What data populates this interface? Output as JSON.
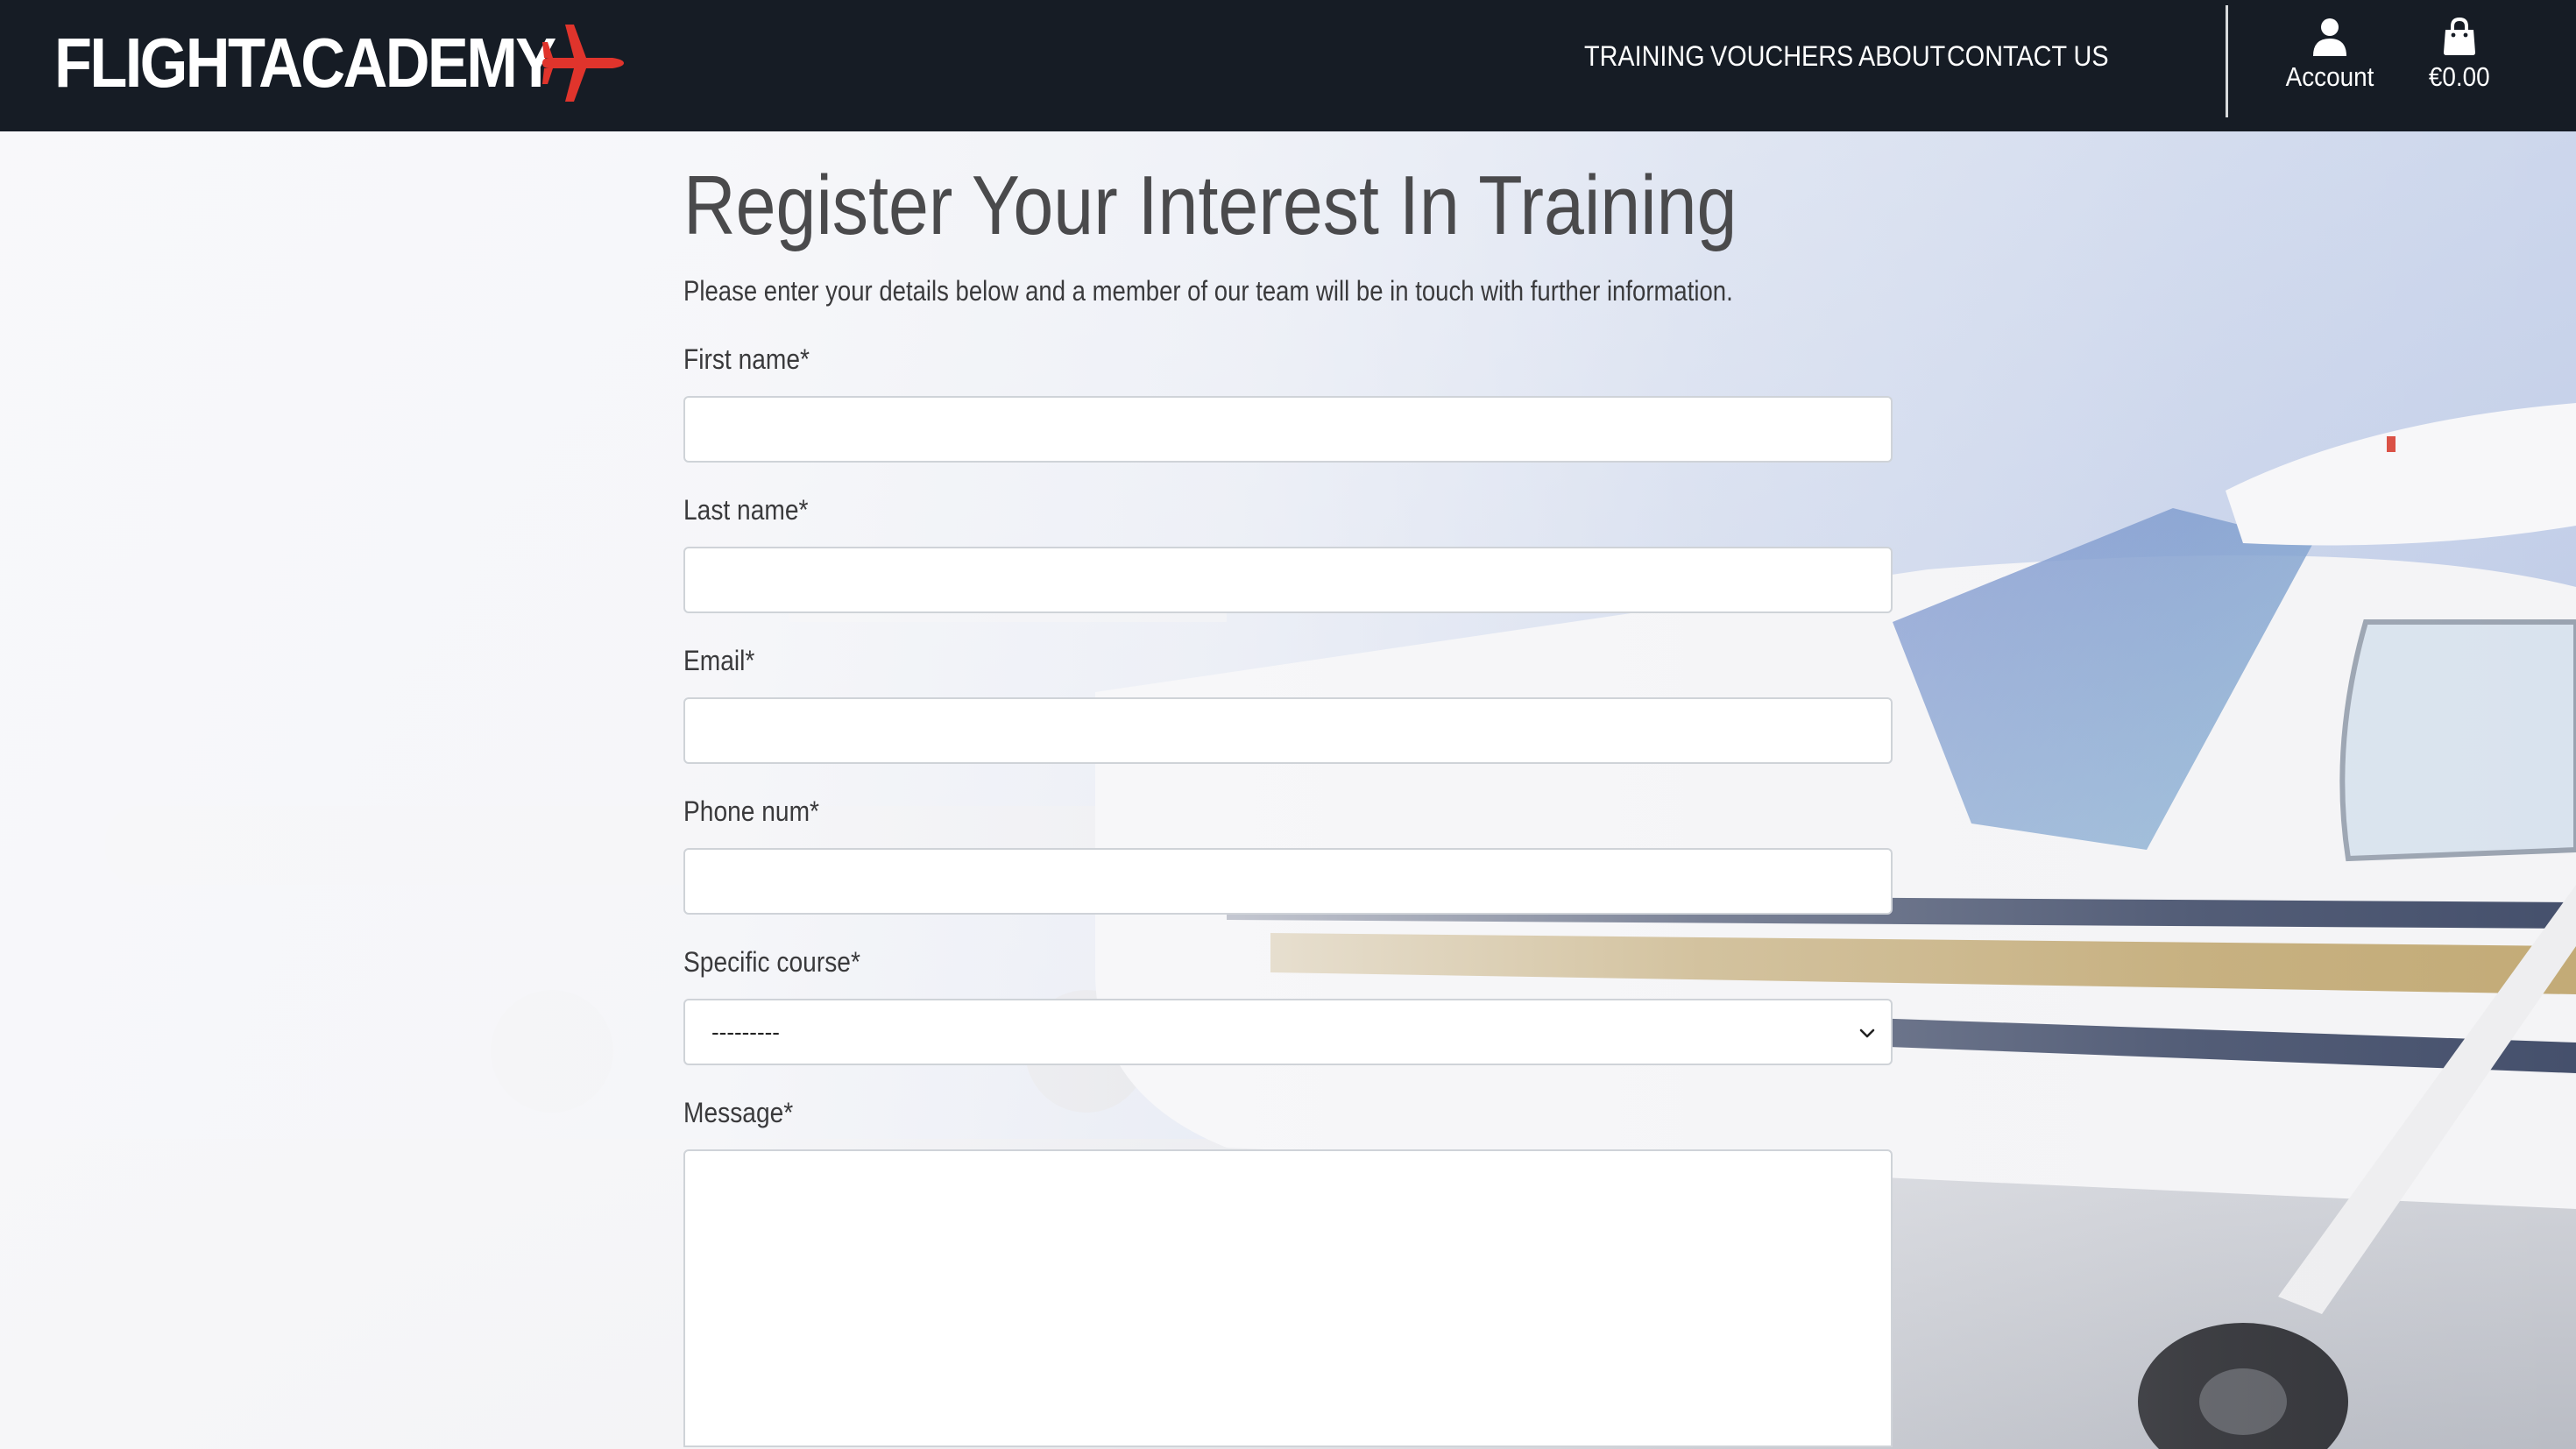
{
  "brand": {
    "name": "FLIGHTACADEMY",
    "logo_icon": "airplane-icon",
    "accent_color": "#e0342c"
  },
  "nav": {
    "links": [
      {
        "label": "TRAINING"
      },
      {
        "label": "VOUCHERS"
      },
      {
        "label": "ABOUT"
      },
      {
        "label": "CONTACT US"
      }
    ],
    "account": {
      "label": "Account",
      "icon": "user-icon"
    },
    "cart": {
      "label": "€0.00",
      "icon": "shopping-bag-icon"
    }
  },
  "page": {
    "title": "Register Your Interest In Training",
    "subtitle": "Please enter your details below and a member of our team will be in touch with further information."
  },
  "form": {
    "first_name": {
      "label": "First name*",
      "value": ""
    },
    "last_name": {
      "label": "Last name*",
      "value": ""
    },
    "email": {
      "label": "Email*",
      "value": ""
    },
    "phone": {
      "label": "Phone num*",
      "value": ""
    },
    "course": {
      "label": "Specific course*",
      "selected": "---------"
    },
    "message": {
      "label": "Message*",
      "value": ""
    }
  },
  "colors": {
    "navbar_bg": "#161c25",
    "text_dark": "#3a3a3c",
    "input_border": "#cfd3d8"
  }
}
